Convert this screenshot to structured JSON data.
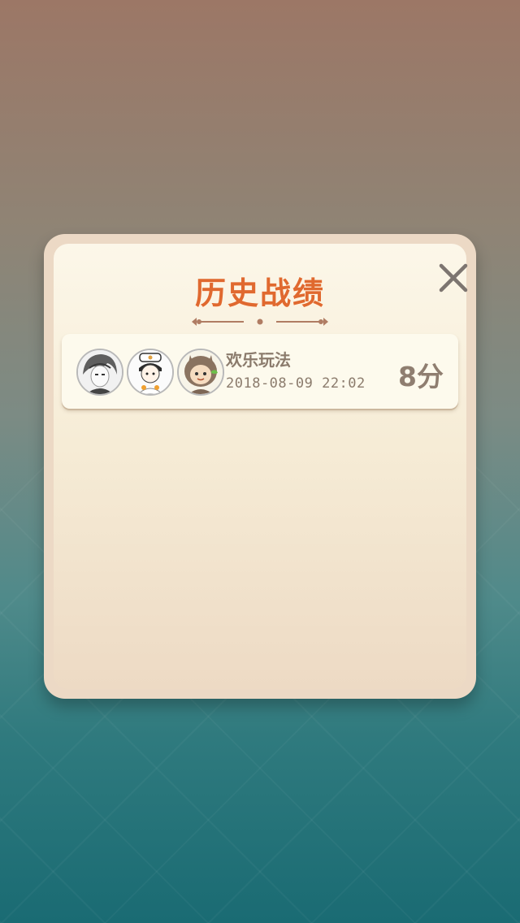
{
  "dialog": {
    "title": "历史战绩",
    "close_icon": "close-icon"
  },
  "records": [
    {
      "players": [
        {
          "avatar": "gray-hair-boy-avatar"
        },
        {
          "avatar": "chef-boy-avatar"
        },
        {
          "avatar": "hooded-monkey-avatar"
        }
      ],
      "mode": "欢乐玩法",
      "datetime": "2018-08-09 22:02",
      "score": "8分"
    }
  ],
  "colors": {
    "title": "#e0692f",
    "text": "#8b7b6c",
    "panel": "#ecd9c5"
  }
}
